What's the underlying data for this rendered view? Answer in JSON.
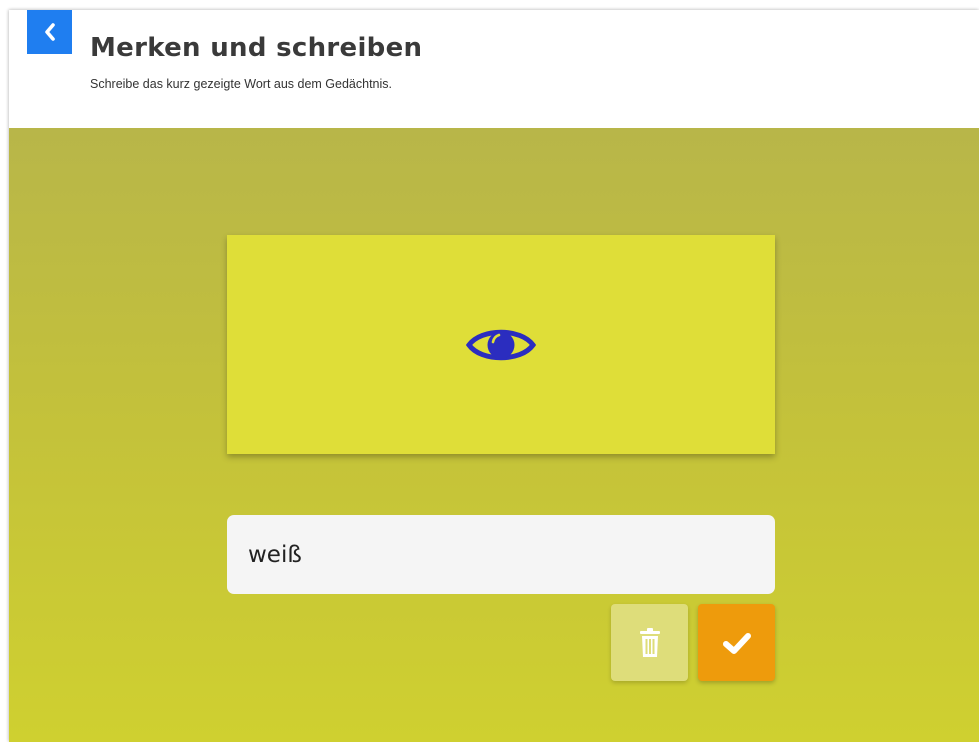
{
  "header": {
    "back_icon": "chevron-left-icon",
    "title": "Merken und schreiben",
    "subtitle": "Schreibe das kurz gezeigte Wort aus dem Gedächtnis."
  },
  "card": {
    "icon": "eye-icon",
    "icon_color": "#2b2dbf"
  },
  "answer": {
    "value": "weiß"
  },
  "actions": {
    "delete_icon": "trash-icon",
    "confirm_icon": "checkmark-icon"
  },
  "colors": {
    "accent_blue": "#1f7ef0",
    "card_yellow": "#dfde38",
    "background_olive": "#c3c13b",
    "confirm_orange": "#ee9b0c",
    "delete_pale": "#dedd7a"
  }
}
